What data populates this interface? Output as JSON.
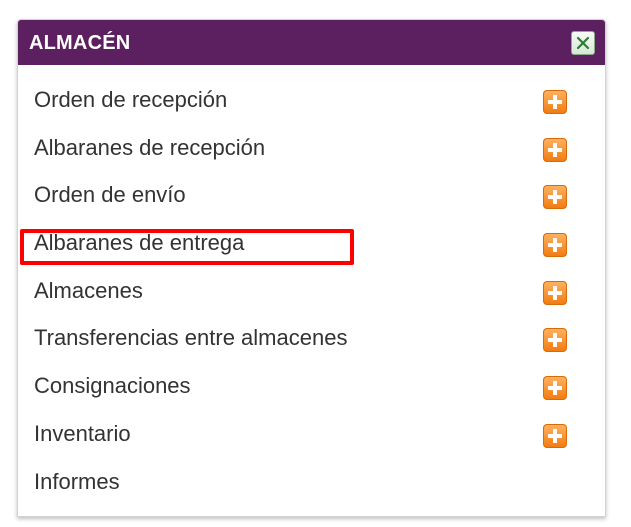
{
  "panel": {
    "title": "ALMACÉN",
    "close_icon": "close-icon",
    "colors": {
      "header_bg": "#5c1f5f",
      "header_text": "#ffffff",
      "plus_icon": "#f27c10",
      "highlight": "#ff0000"
    }
  },
  "menu": {
    "items": [
      {
        "label": "Orden de recepción",
        "has_add": true
      },
      {
        "label": "Albaranes de recepción",
        "has_add": true
      },
      {
        "label": "Orden de envío",
        "has_add": true
      },
      {
        "label": "Albaranes de entrega",
        "has_add": true,
        "highlighted": true
      },
      {
        "label": "Almacenes",
        "has_add": true
      },
      {
        "label": "Transferencias entre almacenes",
        "has_add": true
      },
      {
        "label": "Consignaciones",
        "has_add": true
      },
      {
        "label": "Inventario",
        "has_add": true
      },
      {
        "label": "Informes",
        "has_add": false
      }
    ]
  }
}
